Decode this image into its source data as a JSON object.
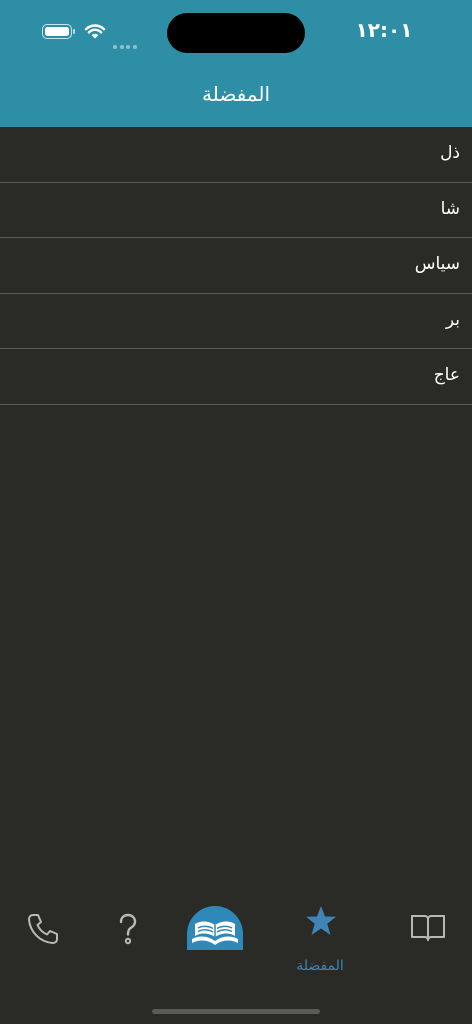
{
  "status_bar": {
    "time": "١٢:٠١"
  },
  "header": {
    "title": "المفضلة"
  },
  "favorites": [
    {
      "label": "ذل"
    },
    {
      "label": "شا"
    },
    {
      "label": "سياس"
    },
    {
      "label": "بر"
    },
    {
      "label": "عاج"
    }
  ],
  "tabbar": {
    "active_tab": "favorites",
    "active_label": "المفضلة",
    "tabs": [
      {
        "id": "contact",
        "icon": "phone-icon"
      },
      {
        "id": "help",
        "icon": "question-icon"
      },
      {
        "id": "home",
        "icon": "book-logo-icon"
      },
      {
        "id": "favorites",
        "icon": "star-icon",
        "label": "المفضلة"
      },
      {
        "id": "dictionary",
        "icon": "open-book-icon"
      }
    ],
    "active_color": "#3f83b7",
    "inactive_color": "#b8b8b4"
  },
  "colors": {
    "header_bg": "#2e8ea6",
    "body_bg": "#2a2a27",
    "separator": "#5b5b58",
    "logo_bg": "#2e88b8"
  }
}
